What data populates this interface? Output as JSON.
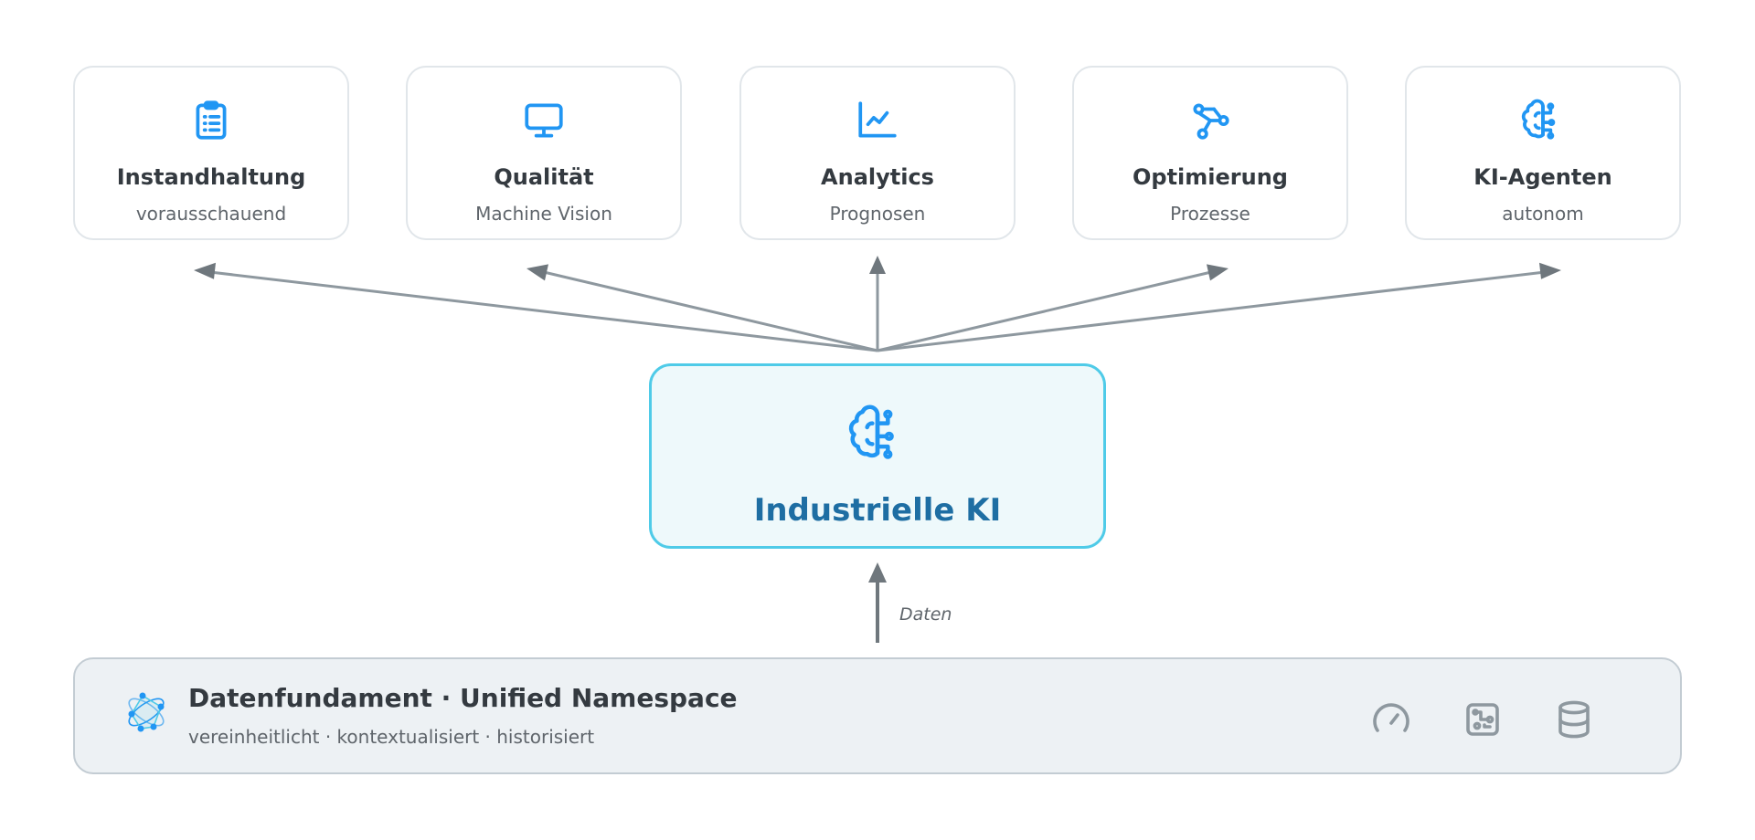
{
  "cards": [
    {
      "title": "Instandhaltung",
      "subtitle": "vorausschauend",
      "icon": "clipboard-list-icon"
    },
    {
      "title": "Qualität",
      "subtitle": "Machine Vision",
      "icon": "monitor-icon"
    },
    {
      "title": "Analytics",
      "subtitle": "Prognosen",
      "icon": "line-chart-icon"
    },
    {
      "title": "Optimierung",
      "subtitle": "Prozesse",
      "icon": "workflow-icon"
    },
    {
      "title": "KI-Agenten",
      "subtitle": "autonom",
      "icon": "brain-circuit-icon"
    }
  ],
  "center": {
    "title": "Industrielle KI",
    "icon": "brain-circuit-icon"
  },
  "flow": {
    "label": "Daten"
  },
  "foundation": {
    "title": "Datenfundament · Unified Namespace",
    "subtitle": "vereinheitlicht · kontextualisiert · historisiert",
    "logo": "network-logo-icon",
    "icons": [
      "gauge-icon",
      "circuit-board-icon",
      "database-icon"
    ]
  },
  "colors": {
    "accent": "#2196f3",
    "center_border": "#4fcbe8",
    "center_fill": "#eef9fb",
    "center_title": "#1e6ea3",
    "arrow": "#8e989f",
    "foundation_fill": "#edf1f4",
    "muted_icon": "#8e989f"
  }
}
